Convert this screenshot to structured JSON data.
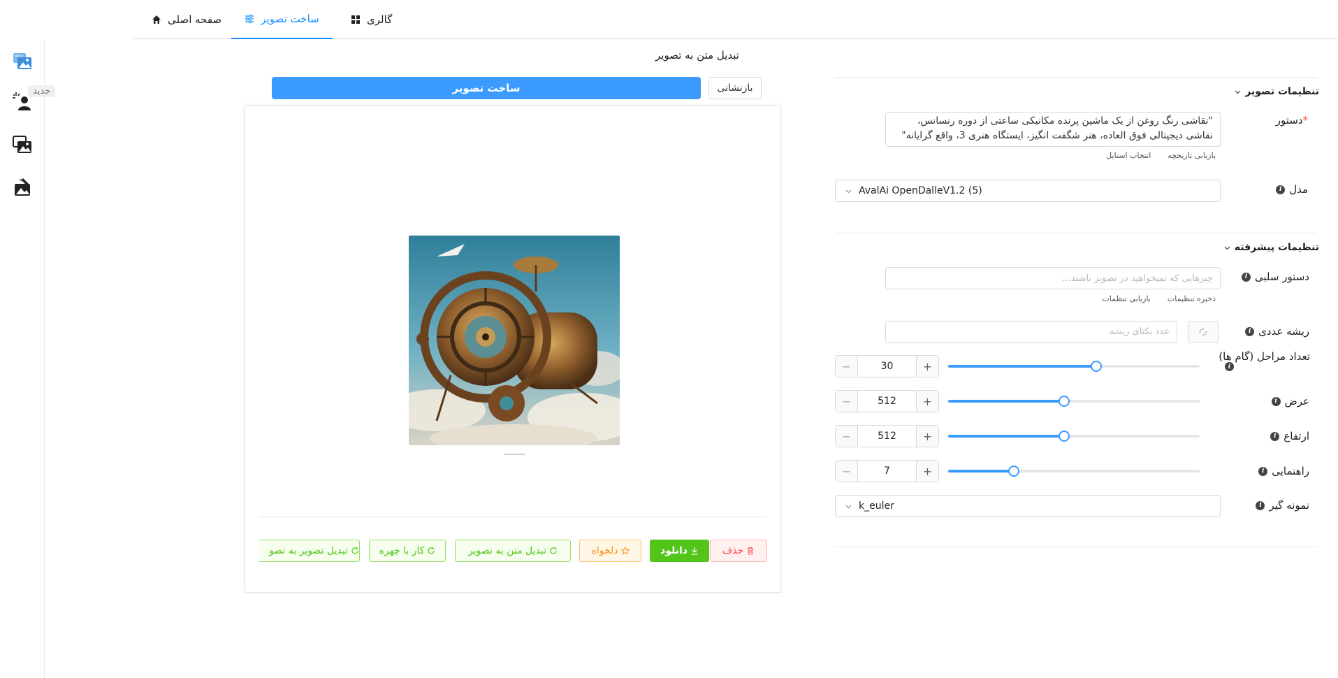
{
  "tabs": [
    {
      "label": "گالری",
      "icon": "grid-icon"
    },
    {
      "label": "ساخت تصویر",
      "icon": "sliders-icon",
      "active": true
    },
    {
      "label": "صفحه اصلی",
      "icon": "home-icon"
    }
  ],
  "rail": {
    "new_badge": "جدید",
    "items": [
      "image-gallery-icon",
      "person-sparkle-icon",
      "images-stack-icon",
      "image-edit-icon"
    ]
  },
  "center": {
    "title": "تبدیل متن به تصویر",
    "reset_label": "بازنشانی",
    "generate_label": "ساخت تصویر",
    "actions": {
      "delete": "حذف",
      "download": "دانلود",
      "favorite": "دلخواه",
      "text_to_image": "تبدیل متن به تصویر",
      "face": "کار با چهره",
      "image_to_image": "تبدیل تصویر به تصو"
    }
  },
  "settings": {
    "image_settings_title": "تنظیمات تصویر",
    "prompt_label": "دستور",
    "prompt_value": "\"نقاشی رنگ روغن از یک ماشین پرنده مکانیکی ساعتی از دوره رنسانس، نقاشی دیجیتالی فوق العاده، هنر شگفت انگیز، ایستگاه هنری 3، واقع گرایانه\"",
    "prompt_links": [
      "بازیابی تاریخچه",
      "انتخاب استایل"
    ],
    "model_label": "مدل",
    "model_value": "AvalAi OpenDalleV1.2 (5)",
    "advanced_title": "تنظیمات پیشرفته",
    "negative_label": "دستور سلبی",
    "negative_placeholder": "چیزهایی که نمیخواهید در تصویر باشند...",
    "negative_links": [
      "ذخیره تنظیمات",
      "بازیابی تنظمات"
    ],
    "seed_label": "ریشه عددی",
    "seed_placeholder": "عدد یکتای ریشه",
    "steps_label": "تعداد مراحل (گام ها)",
    "steps_value": "30",
    "steps_fraction": 0.59,
    "width_label": "عرض",
    "width_value": "512",
    "width_fraction": 0.46,
    "height_label": "ارتفاع",
    "height_value": "512",
    "height_fraction": 0.46,
    "guidance_label": "راهنمایی",
    "guidance_value": "7",
    "guidance_fraction": 0.26,
    "sampler_label": "نمونه گیر",
    "sampler_value": "k_euler"
  },
  "colors": {
    "accent": "#3b9bff",
    "download": "#52c41a",
    "delete": "#ff4d4f",
    "favorite": "#fa8c16"
  }
}
